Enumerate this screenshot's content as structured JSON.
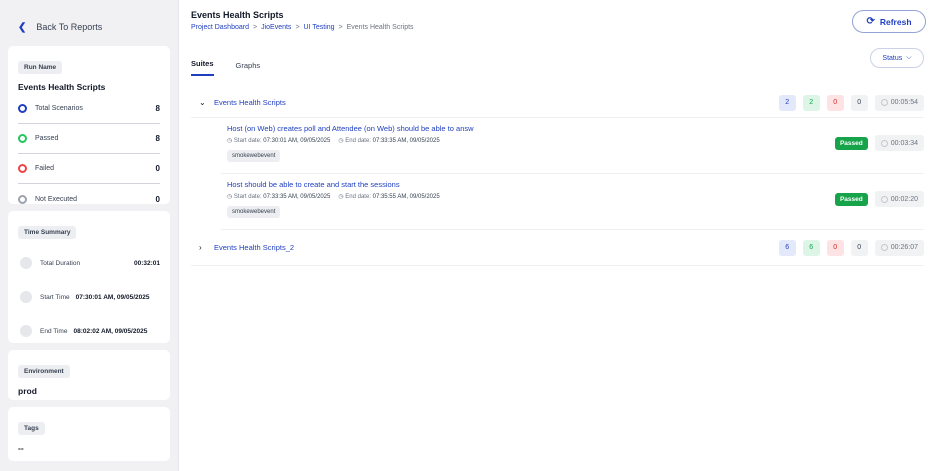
{
  "sidebar": {
    "back_label": "Back To Reports",
    "run": {
      "pill": "Run Name",
      "title": "Events Health Scripts",
      "stats": [
        {
          "label": "Total Scenarios",
          "value": "8",
          "color": "#1f3fbf"
        },
        {
          "label": "Passed",
          "value": "8",
          "color": "#22c55e"
        },
        {
          "label": "Failed",
          "value": "0",
          "color": "#ef4444"
        },
        {
          "label": "Not Executed",
          "value": "0",
          "color": "#9ca3af"
        }
      ]
    },
    "time": {
      "pill": "Time Summary",
      "rows": [
        {
          "label": "Total Duration",
          "value": "00:32:01"
        },
        {
          "label": "Start Time",
          "value": "07:30:01 AM, 09/05/2025"
        },
        {
          "label": "End Time",
          "value": "08:02:02 AM, 09/05/2025"
        }
      ]
    },
    "environment": {
      "pill": "Environment",
      "value": "prod"
    },
    "tags": {
      "pill": "Tags",
      "value": "--"
    }
  },
  "header": {
    "title": "Events Health Scripts",
    "breadcrumb": [
      "Project Dashboard",
      ">",
      "JioEvents",
      ">",
      "UI Testing",
      ">",
      "Events Health Scripts"
    ],
    "refresh_label": "Refresh"
  },
  "tabs": [
    {
      "label": "Suites",
      "active": true
    },
    {
      "label": "Graphs",
      "active": false
    }
  ],
  "status_label": "Status",
  "suites": [
    {
      "name": "Events Health Scripts",
      "expanded": true,
      "total": "2",
      "passed": "2",
      "failed": "0",
      "skipped": "0",
      "duration": "00:05:54",
      "cases": [
        {
          "title": "Host (on Web) creates poll and Attendee (on Web) should be able to answ",
          "start_label": "Start date:",
          "start": "07:30:01 AM, 09/05/2025",
          "end_label": "End date:",
          "end": "07:33:35 AM, 09/05/2025",
          "tag": "smokewebevent",
          "status": "Passed",
          "duration": "00:03:34"
        },
        {
          "title": "Host should be able to create and start the sessions",
          "start_label": "Start date:",
          "start": "07:33:35 AM, 09/05/2025",
          "end_label": "End date:",
          "end": "07:35:55 AM, 09/05/2025",
          "tag": "smokewebevent",
          "status": "Passed",
          "duration": "00:02:20"
        }
      ]
    },
    {
      "name": "Events Health Scripts_2",
      "expanded": false,
      "total": "6",
      "passed": "6",
      "failed": "0",
      "skipped": "0",
      "duration": "00:26:07"
    }
  ]
}
